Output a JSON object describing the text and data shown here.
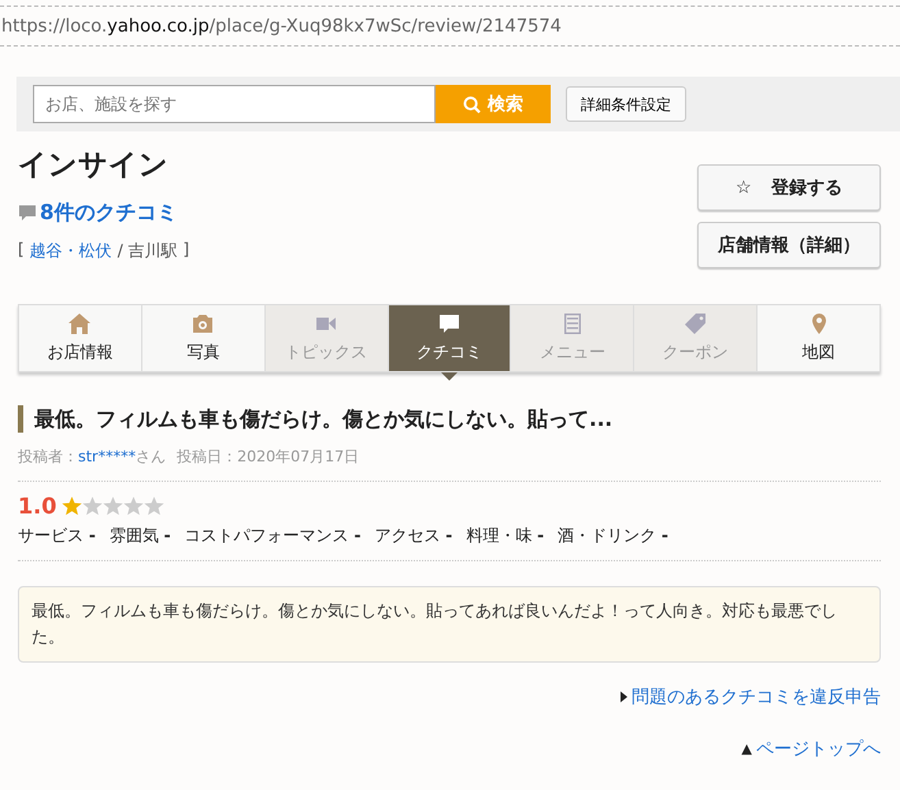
{
  "address_bar": {
    "url_prefix": "https://loco.",
    "url_domain": "yahoo.co.jp",
    "url_path": "/place/g-Xuq98kx7wSc/review/2147574"
  },
  "search": {
    "placeholder": "お店、施設を探す",
    "button": "検索",
    "advanced_button": "詳細条件設定"
  },
  "place": {
    "name": "インサイン",
    "review_count": "8件のクチコミ",
    "area": "越谷・松伏",
    "station": "/ 吉川駅",
    "bracket_open": "[",
    "bracket_close": "]"
  },
  "actions": [
    {
      "icon": "☆",
      "label": "登録する"
    },
    {
      "label": "店舗情報（詳細）"
    }
  ],
  "tabs": [
    {
      "label": "お店情報",
      "selected": false,
      "disabled": false
    },
    {
      "label": "写真",
      "selected": false,
      "disabled": false
    },
    {
      "label": "トピックス",
      "selected": false,
      "disabled": true
    },
    {
      "label": "クチコミ",
      "selected": true,
      "disabled": false
    },
    {
      "label": "メニュー",
      "selected": false,
      "disabled": true
    },
    {
      "label": "クーポン",
      "selected": false,
      "disabled": true
    },
    {
      "label": "地図",
      "selected": false,
      "disabled": false
    }
  ],
  "review": {
    "title": "最低。フィルムも車も傷だらけ。傷とか気にしない。貼って...",
    "author_label": "投稿者：",
    "author": "str*****",
    "author_suffix": "さん",
    "date": "投稿日：2020年07月17日",
    "score": "1.0",
    "stars": 1,
    "subratings": [
      {
        "label": "サービス",
        "value": "-"
      },
      {
        "label": "雰囲気",
        "value": "-"
      },
      {
        "label": "コストパフォーマンス",
        "value": "-"
      },
      {
        "label": "アクセス",
        "value": "-"
      },
      {
        "label": "料理・味",
        "value": "-"
      },
      {
        "label": "酒・ドリンク",
        "value": "-"
      }
    ],
    "body": "最低。フィルムも車も傷だらけ。傷とか気にしない。貼ってあれば良いんだよ！って人向き。対応も最悪でした。"
  },
  "report_link": "問題のあるクチコミを違反申告",
  "page_top_icon": "▲",
  "page_top_link": "ページトップへ"
}
